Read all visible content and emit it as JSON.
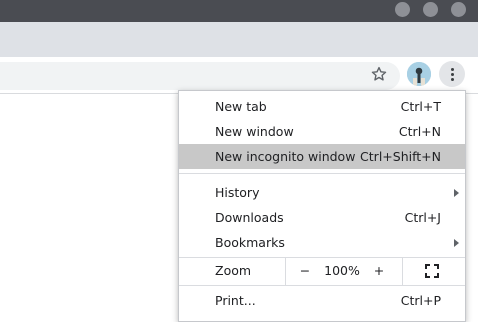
{
  "colors": {
    "titlebar": "#4a4c52",
    "tabstrip": "#dee1e6",
    "highlight": "#c8c8c8"
  },
  "toolbar": {
    "bookmark_icon": "star-outline-icon",
    "profile_icon": "profile-avatar",
    "menu_icon": "three-dot-vertical-icon"
  },
  "menu": {
    "items_top": [
      {
        "label": "New tab",
        "shortcut": "Ctrl+T"
      },
      {
        "label": "New window",
        "shortcut": "Ctrl+N"
      },
      {
        "label": "New incognito window",
        "shortcut": "Ctrl+Shift+N",
        "highlighted": true
      }
    ],
    "items_mid": [
      {
        "label": "History",
        "submenu": true
      },
      {
        "label": "Downloads",
        "shortcut": "Ctrl+J"
      },
      {
        "label": "Bookmarks",
        "submenu": true
      }
    ],
    "zoom": {
      "label": "Zoom",
      "minus": "−",
      "value": "100%",
      "plus": "+",
      "fullscreen_icon": "fullscreen-icon"
    },
    "items_bottom": [
      {
        "label": "Print...",
        "shortcut": "Ctrl+P"
      }
    ]
  }
}
